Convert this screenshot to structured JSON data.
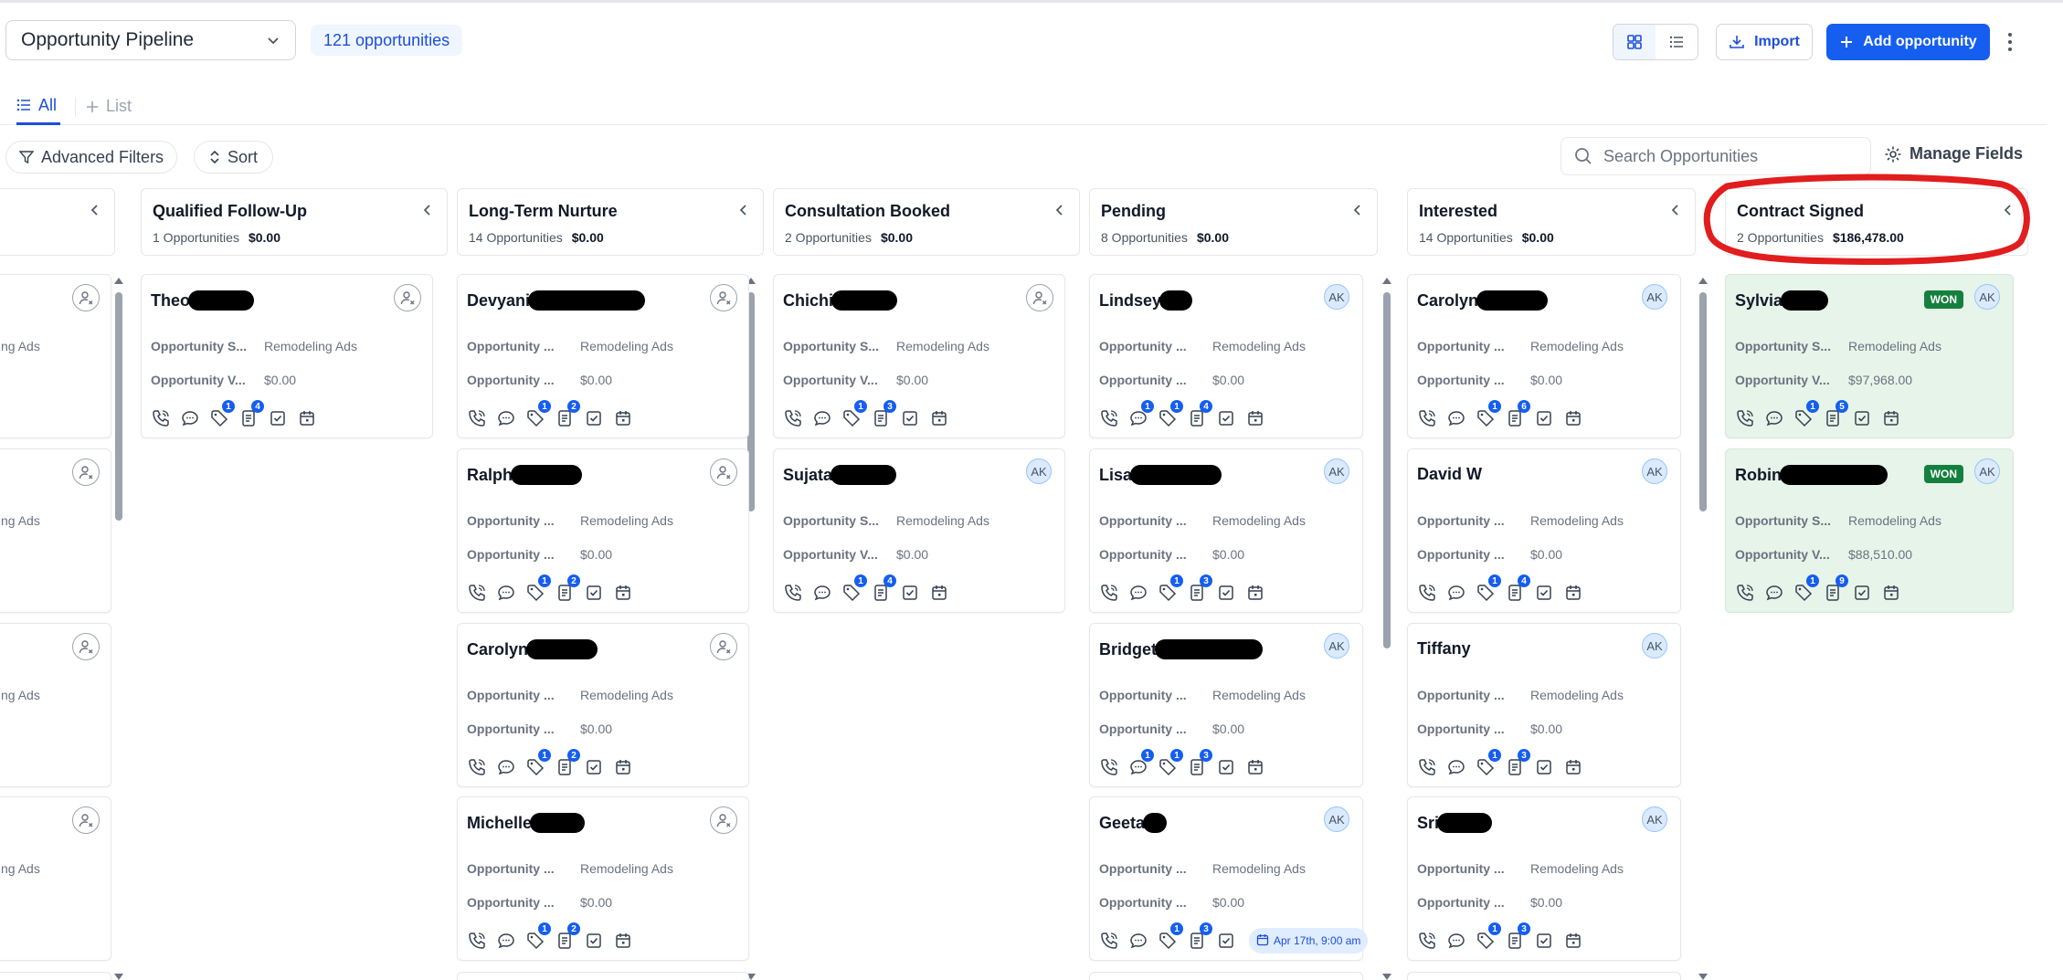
{
  "header": {
    "pipeline": "Opportunity Pipeline",
    "count": "121 opportunities",
    "import_label": "Import",
    "add_label": "Add opportunity"
  },
  "tabs": {
    "all": "All",
    "list": "List"
  },
  "filters": {
    "advanced": "Advanced Filters",
    "sort": "Sort",
    "search_placeholder": "Search Opportunities",
    "manage_fields": "Manage Fields"
  },
  "colors": {
    "primary": "#155eef",
    "won": "#15803d",
    "won_card_bg": "#e6f4ea",
    "annotation": "#e11d1d"
  },
  "partial_column": {
    "cards": [
      {
        "source_fragment": "ng Ads"
      },
      {
        "source_fragment": "ng Ads"
      },
      {
        "source_fragment": "ng Ads"
      },
      {
        "source_fragment": "ng Ads"
      }
    ]
  },
  "columns": [
    {
      "title": "Qualified Follow-Up",
      "count": "1 Opportunities",
      "value": "$0.00",
      "cards": [
        {
          "name": "Theo",
          "src_label": "Opportunity S...",
          "src": "Remodeling Ads",
          "val_label": "Opportunity V...",
          "val": "$0.00",
          "assignee": "",
          "badges": [
            "",
            "1",
            "4"
          ]
        }
      ]
    },
    {
      "title": "Long-Term Nurture",
      "count": "14 Opportunities",
      "value": "$0.00",
      "cards": [
        {
          "name": "Devyani",
          "src_label": "Opportunity ...",
          "src": "Remodeling Ads",
          "val_label": "Opportunity ...",
          "val": "$0.00",
          "assignee": "",
          "badges": [
            "",
            "1",
            "2"
          ]
        },
        {
          "name": "Ralph",
          "src_label": "Opportunity ...",
          "src": "Remodeling Ads",
          "val_label": "Opportunity ...",
          "val": "$0.00",
          "assignee": "",
          "badges": [
            "",
            "1",
            "2"
          ]
        },
        {
          "name": "Carolyn",
          "src_label": "Opportunity ...",
          "src": "Remodeling Ads",
          "val_label": "Opportunity ...",
          "val": "$0.00",
          "assignee": "",
          "badges": [
            "",
            "1",
            "2"
          ]
        },
        {
          "name": "Michelle",
          "src_label": "Opportunity ...",
          "src": "Remodeling Ads",
          "val_label": "Opportunity ...",
          "val": "$0.00",
          "assignee": "",
          "badges": [
            "",
            "1",
            "2"
          ]
        }
      ]
    },
    {
      "title": "Consultation Booked",
      "count": "2 Opportunities",
      "value": "$0.00",
      "cards": [
        {
          "name": "Chichi",
          "src_label": "Opportunity S...",
          "src": "Remodeling Ads",
          "val_label": "Opportunity V...",
          "val": "$0.00",
          "assignee": "",
          "badges": [
            "",
            "1",
            "3"
          ]
        },
        {
          "name": "Sujata",
          "src_label": "Opportunity S...",
          "src": "Remodeling Ads",
          "val_label": "Opportunity V...",
          "val": "$0.00",
          "assignee": "AK",
          "badges": [
            "",
            "1",
            "4"
          ]
        }
      ]
    },
    {
      "title": "Pending",
      "count": "8 Opportunities",
      "value": "$0.00",
      "cards": [
        {
          "name": "Lindsey",
          "src_label": "Opportunity ...",
          "src": "Remodeling Ads",
          "val_label": "Opportunity ...",
          "val": "$0.00",
          "assignee": "AK",
          "badges": [
            "1",
            "1",
            "4"
          ]
        },
        {
          "name": "Lisa",
          "src_label": "Opportunity ...",
          "src": "Remodeling Ads",
          "val_label": "Opportunity ...",
          "val": "$0.00",
          "assignee": "AK",
          "badges": [
            "",
            "1",
            "3"
          ]
        },
        {
          "name": "Bridget",
          "src_label": "Opportunity ...",
          "src": "Remodeling Ads",
          "val_label": "Opportunity ...",
          "val": "$0.00",
          "assignee": "AK",
          "badges": [
            "1",
            "1",
            "3"
          ]
        },
        {
          "name": "Geeta",
          "src_label": "Opportunity ...",
          "src": "Remodeling Ads",
          "val_label": "Opportunity ...",
          "val": "$0.00",
          "assignee": "AK",
          "badges": [
            "",
            "1",
            "3"
          ],
          "appointment": "Apr 17th, 9:00 am"
        }
      ]
    },
    {
      "title": "Interested",
      "count": "14 Opportunities",
      "value": "$0.00",
      "cards": [
        {
          "name": "Carolyn",
          "src_label": "Opportunity ...",
          "src": "Remodeling Ads",
          "val_label": "Opportunity ...",
          "val": "$0.00",
          "assignee": "AK",
          "badges": [
            "",
            "1",
            "6"
          ]
        },
        {
          "name": "David W",
          "src_label": "Opportunity ...",
          "src": "Remodeling Ads",
          "val_label": "Opportunity ...",
          "val": "$0.00",
          "assignee": "AK",
          "badges": [
            "",
            "1",
            "4"
          ]
        },
        {
          "name": "Tiffany",
          "src_label": "Opportunity ...",
          "src": "Remodeling Ads",
          "val_label": "Opportunity ...",
          "val": "$0.00",
          "assignee": "AK",
          "badges": [
            "",
            "1",
            "3"
          ]
        },
        {
          "name": "Sri",
          "src_label": "Opportunity ...",
          "src": "Remodeling Ads",
          "val_label": "Opportunity ...",
          "val": "$0.00",
          "assignee": "AK",
          "badges": [
            "",
            "1",
            "3"
          ]
        }
      ]
    },
    {
      "title": "Contract Signed",
      "count": "2 Opportunities",
      "value": "$186,478.00",
      "cards": [
        {
          "name": "Sylvia",
          "src_label": "Opportunity S...",
          "src": "Remodeling Ads",
          "val_label": "Opportunity V...",
          "val": "$97,968.00",
          "assignee": "AK",
          "status": "WON",
          "badges": [
            "",
            "1",
            "5"
          ]
        },
        {
          "name": "Robin",
          "src_label": "Opportunity S...",
          "src": "Remodeling Ads",
          "val_label": "Opportunity V...",
          "val": "$88,510.00",
          "assignee": "AK",
          "status": "WON",
          "badges": [
            "",
            "1",
            "9"
          ]
        }
      ]
    }
  ]
}
